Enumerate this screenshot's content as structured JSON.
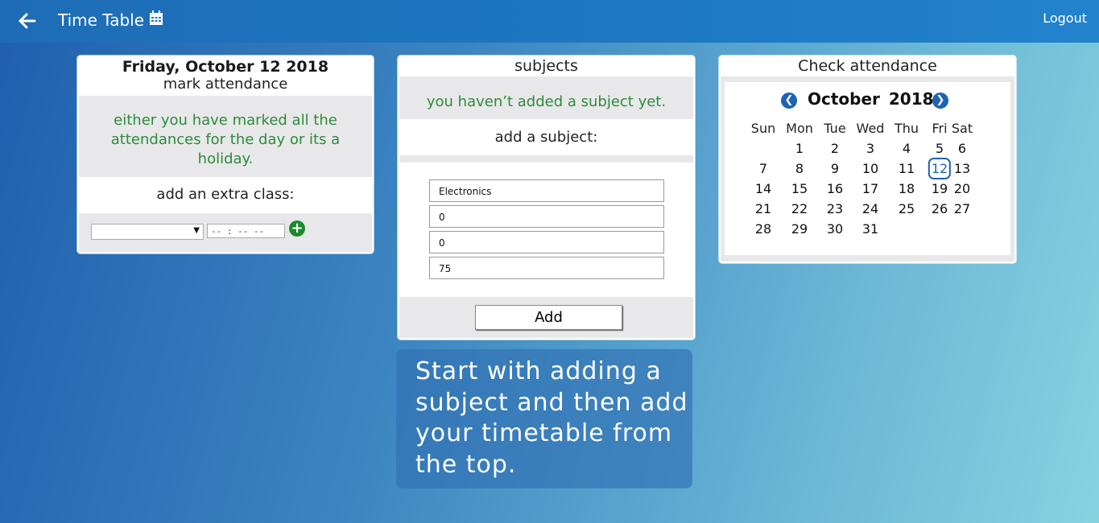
{
  "header": {
    "title": "Time Table",
    "logout_label": "Logout",
    "icons": [
      "back-arrow-icon",
      "calendar-icon"
    ]
  },
  "mark_card": {
    "date": "Friday, October 12 2018",
    "subtitle": "mark attendance",
    "message": "either you have marked all the attendances for the day or its a holiday.",
    "extra_label": "add an extra class:",
    "time_placeholder": "-- : --  --",
    "add_icon": "plus-circle-icon"
  },
  "subjects_card": {
    "heading": "subjects",
    "message": "you haven’t added a subject yet.",
    "add_label": "add a subject:",
    "fields": [
      "Electronics",
      "0",
      "0",
      "75"
    ],
    "add_button": "Add"
  },
  "tip": {
    "text": "Start with adding a subject and then add your timetable from the top."
  },
  "calendar": {
    "heading": "Check attendance",
    "month": "October",
    "year": "2018",
    "weekdays": [
      "Sun",
      "Mon",
      "Tue",
      "Wed",
      "Thu",
      "Fri",
      "Sat"
    ],
    "weeks": [
      [
        "",
        "1",
        "2",
        "3",
        "4",
        "5",
        "6"
      ],
      [
        "7",
        "8",
        "9",
        "10",
        "11",
        "12",
        "13"
      ],
      [
        "14",
        "15",
        "16",
        "17",
        "18",
        "19",
        "20"
      ],
      [
        "21",
        "22",
        "23",
        "24",
        "25",
        "26",
        "27"
      ],
      [
        "28",
        "29",
        "30",
        "31",
        "",
        "",
        ""
      ]
    ],
    "today": "12",
    "accent": "#1e63b0"
  },
  "colors": {
    "topbar": "#1e78c2",
    "message_green": "#2e8b3a",
    "grey_box": "#e8e8ea"
  }
}
